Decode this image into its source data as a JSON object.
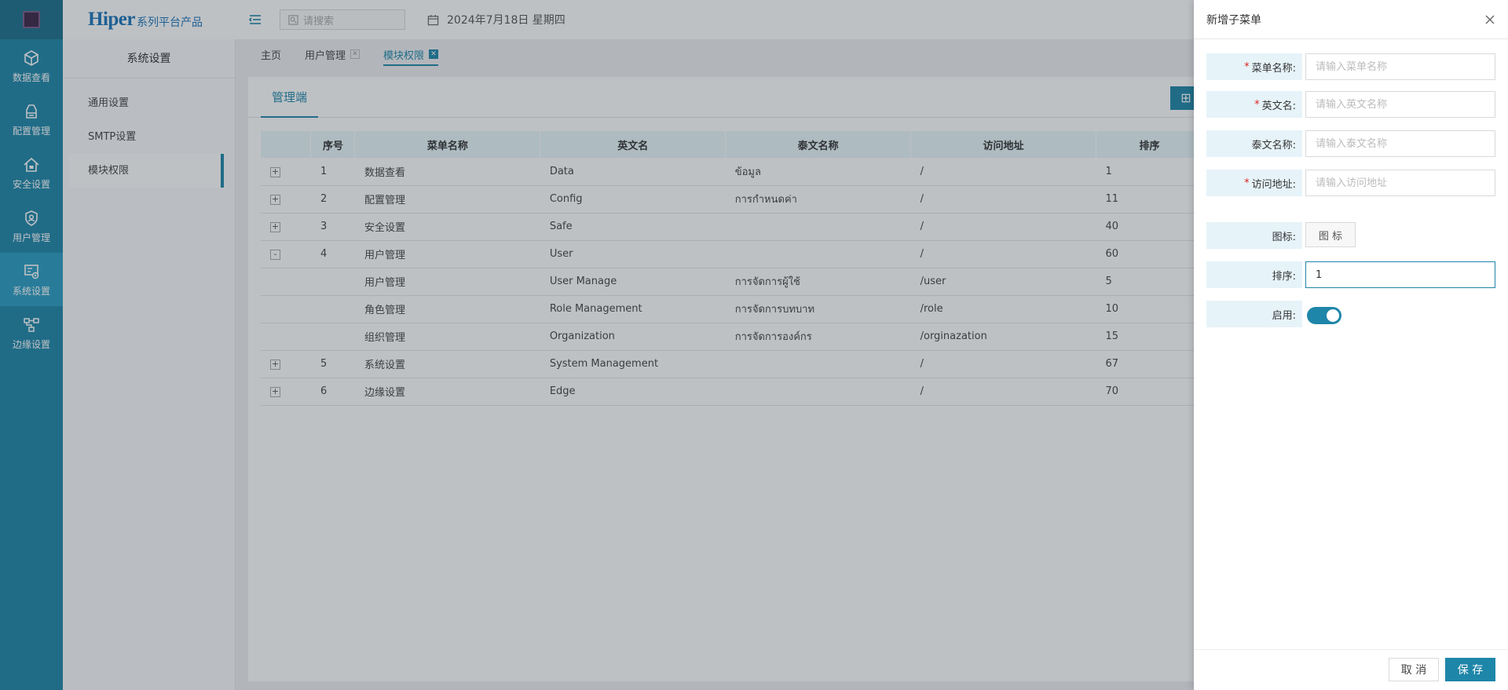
{
  "brand": {
    "name": "Hiper",
    "subtitle": "系列平台产品"
  },
  "header": {
    "search_placeholder": "请搜索",
    "date": "2024年7月18日 星期四"
  },
  "rail": [
    {
      "label": "数据查看",
      "icon": "cube-icon"
    },
    {
      "label": "配置管理",
      "icon": "config-icon"
    },
    {
      "label": "安全设置",
      "icon": "home-lock-icon"
    },
    {
      "label": "用户管理",
      "icon": "shield-user-icon"
    },
    {
      "label": "系统设置",
      "icon": "settings-screen-icon",
      "active": true
    },
    {
      "label": "边缘设置",
      "icon": "edge-network-icon"
    }
  ],
  "subnav": {
    "title": "系统设置",
    "items": [
      "通用设置",
      "SMTP设置",
      "模块权限"
    ]
  },
  "tabs": [
    "主页",
    "用户管理",
    "模块权限"
  ],
  "main": {
    "tab": "管理端",
    "table": {
      "columns": [
        "",
        "序号",
        "菜单名称",
        "英文名",
        "泰文名称",
        "访问地址",
        "排序"
      ],
      "rows": [
        {
          "exp": "+",
          "no": "1",
          "name": "数据查看",
          "en": "Data",
          "th": "ข้อมูล",
          "url": "/",
          "sort": "1"
        },
        {
          "exp": "+",
          "no": "2",
          "name": "配置管理",
          "en": "Config",
          "th": "การกำหนดค่า",
          "url": "/",
          "sort": "11"
        },
        {
          "exp": "+",
          "no": "3",
          "name": "安全设置",
          "en": "Safe",
          "th": "",
          "url": "/",
          "sort": "40"
        },
        {
          "exp": "-",
          "no": "4",
          "name": "用户管理",
          "en": "User",
          "th": "",
          "url": "/",
          "sort": "60"
        },
        {
          "exp": "",
          "no": "",
          "name": "用户管理",
          "en": "User Manage",
          "th": "การจัดการผู้ใช้",
          "url": "/user",
          "sort": "5"
        },
        {
          "exp": "",
          "no": "",
          "name": "角色管理",
          "en": "Role Management",
          "th": "การจัดการบทบาท",
          "url": "/role",
          "sort": "10"
        },
        {
          "exp": "",
          "no": "",
          "name": "组织管理",
          "en": "Organization",
          "th": "การจัดการองค์กร",
          "url": "/orginazation",
          "sort": "15"
        },
        {
          "exp": "+",
          "no": "5",
          "name": "系统设置",
          "en": "System Management",
          "th": "",
          "url": "/",
          "sort": "67"
        },
        {
          "exp": "+",
          "no": "6",
          "name": "边缘设置",
          "en": "Edge",
          "th": "",
          "url": "/",
          "sort": "70"
        }
      ]
    }
  },
  "drawer": {
    "title": "新增子菜单",
    "fields": {
      "menu_name": {
        "label": "菜单名称:",
        "placeholder": "请输入菜单名称",
        "required": true
      },
      "en_name": {
        "label": "英文名:",
        "placeholder": "请输入英文名称",
        "required": true
      },
      "th_name": {
        "label": "泰文名称:",
        "placeholder": "请输入泰文名称",
        "required": false
      },
      "url": {
        "label": "访问地址:",
        "placeholder": "请输入访问地址",
        "required": true
      },
      "icon": {
        "label": "图标:",
        "button": "图 标"
      },
      "sort": {
        "label": "排序:",
        "value": "1"
      },
      "enabled": {
        "label": "启用:",
        "value": true
      }
    },
    "required_mark": "*",
    "cancel": "取 消",
    "save": "保 存"
  },
  "colors": {
    "accent": "#1e86a8",
    "required": "#e02020"
  }
}
